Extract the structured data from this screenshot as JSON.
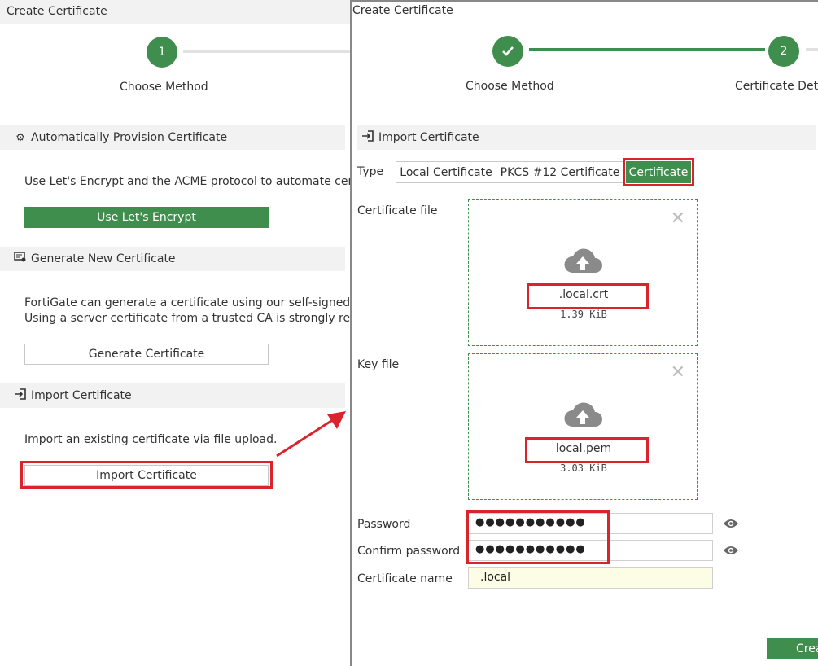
{
  "left": {
    "title": "Create Certificate",
    "step1_number": "1",
    "step1_label": "Choose Method",
    "auto_section": {
      "heading": "Automatically Provision Certificate",
      "description": "Use Let's Encrypt and the ACME protocol to automate certifi",
      "button": "Use Let's Encrypt"
    },
    "generate_section": {
      "heading": "Generate New Certificate",
      "description_line1": "FortiGate can generate a certificate using our self-signed CA:",
      "description_line2": "Using a server certificate from a trusted CA is strongly recom",
      "button": "Generate Certificate"
    },
    "import_section": {
      "heading": "Import Certificate",
      "description": "Import an existing certificate via file upload.",
      "button": "Import Certificate"
    }
  },
  "right": {
    "title": "Create Certificate",
    "step1_label": "Choose Method",
    "step2_number": "2",
    "step2_label": "Certificate Deta",
    "section_heading": "Import Certificate",
    "type_label": "Type",
    "type_options": [
      "Local Certificate",
      "PKCS #12 Certificate",
      "Certificate"
    ],
    "type_selected": "Certificate",
    "cert_file_label": "Certificate file",
    "cert_file_name": ".local.crt",
    "cert_file_size": "1.39 KiB",
    "key_file_label": "Key file",
    "key_file_name": "local.pem",
    "key_file_size": "3.03 KiB",
    "password_label": "Password",
    "password_value": "●●●●●●●●●●●",
    "confirm_label": "Confirm password",
    "confirm_value": "●●●●●●●●●●●",
    "name_label": "Certificate name",
    "name_value": ".local",
    "create_button": "Crea"
  },
  "colors": {
    "accent_green": "#3f8e4d",
    "highlight_red": "#d9232d",
    "section_bg": "#f2f2f2"
  }
}
